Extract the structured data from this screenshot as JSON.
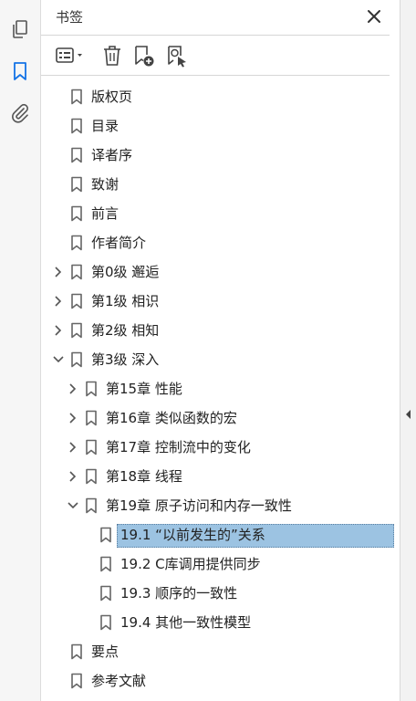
{
  "panel": {
    "title": "书签"
  },
  "leftbar": {
    "icons": [
      "pages-icon",
      "bookmark-icon",
      "attachment-icon"
    ]
  },
  "toolbar": {
    "icons": [
      "options-menu-icon",
      "delete-bookmark-icon",
      "new-bookmark-icon",
      "find-bookmark-icon"
    ]
  },
  "bookmarks": [
    {
      "label": "版权页",
      "level": 0,
      "expandable": false
    },
    {
      "label": "目录",
      "level": 0,
      "expandable": false
    },
    {
      "label": "译者序",
      "level": 0,
      "expandable": false
    },
    {
      "label": "致谢",
      "level": 0,
      "expandable": false
    },
    {
      "label": "前言",
      "level": 0,
      "expandable": false
    },
    {
      "label": "作者简介",
      "level": 0,
      "expandable": false
    },
    {
      "label": "第0级 邂逅",
      "level": 0,
      "expandable": true,
      "expanded": false
    },
    {
      "label": "第1级 相识",
      "level": 0,
      "expandable": true,
      "expanded": false
    },
    {
      "label": "第2级 相知",
      "level": 0,
      "expandable": true,
      "expanded": false
    },
    {
      "label": "第3级 深入",
      "level": 0,
      "expandable": true,
      "expanded": true
    },
    {
      "label": "第15章 性能",
      "level": 1,
      "expandable": true,
      "expanded": false
    },
    {
      "label": "第16章 类似函数的宏",
      "level": 1,
      "expandable": true,
      "expanded": false
    },
    {
      "label": "第17章 控制流中的变化",
      "level": 1,
      "expandable": true,
      "expanded": false
    },
    {
      "label": "第18章 线程",
      "level": 1,
      "expandable": true,
      "expanded": false
    },
    {
      "label": "第19章 原子访问和内存一致性",
      "level": 1,
      "expandable": true,
      "expanded": true
    },
    {
      "label": "19.1 “以前发生的”关系",
      "level": 2,
      "expandable": false,
      "selected": true
    },
    {
      "label": "19.2 C库调用提供同步",
      "level": 2,
      "expandable": false
    },
    {
      "label": "19.3 顺序的一致性",
      "level": 2,
      "expandable": false
    },
    {
      "label": "19.4 其他一致性模型",
      "level": 2,
      "expandable": false
    },
    {
      "label": "要点",
      "level": 0,
      "expandable": false
    },
    {
      "label": "参考文献",
      "level": 0,
      "expandable": false
    }
  ],
  "colors": {
    "accent": "#1473e6",
    "selection": "#9cc3e2"
  }
}
